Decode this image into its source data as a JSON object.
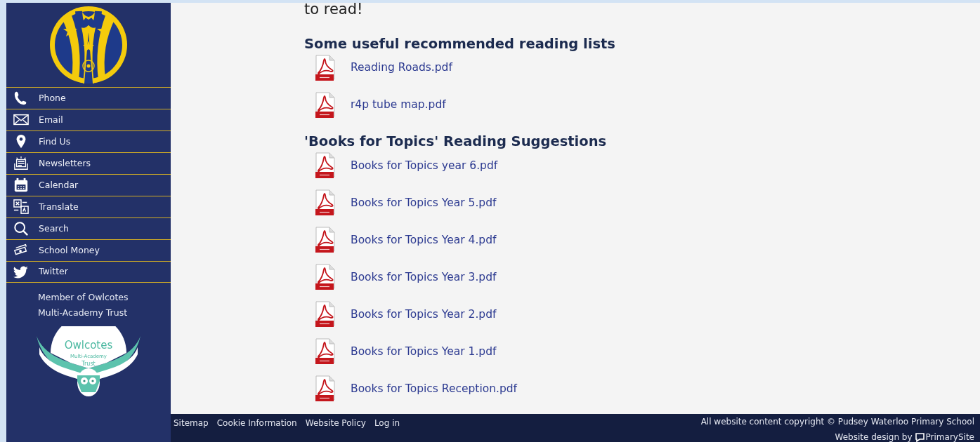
{
  "sidebar": {
    "nav_items": [
      {
        "label": "Phone",
        "kind": "phone"
      },
      {
        "label": "Email",
        "kind": "email"
      },
      {
        "label": "Find Us",
        "kind": "pin"
      },
      {
        "label": "Newsletters",
        "kind": "newsletter"
      },
      {
        "label": "Calendar",
        "kind": "calendar"
      },
      {
        "label": "Translate",
        "kind": "translate"
      },
      {
        "label": "Search",
        "kind": "search"
      },
      {
        "label": "School Money",
        "kind": "money"
      },
      {
        "label": "Twitter",
        "kind": "twitter"
      }
    ],
    "member_lines": [
      "Member of Owlcotes",
      "Multi-Academy Trust"
    ],
    "trust_logo": {
      "name": "Owlcotes",
      "line2": "Multi-Academy",
      "line3": "Trust"
    }
  },
  "content": {
    "intro_tail": "to read!",
    "sections": [
      {
        "heading": "Some useful recommended reading lists",
        "files": [
          "Reading Roads.pdf",
          "r4p tube map.pdf"
        ]
      },
      {
        "heading": "'Books for Topics' Reading Suggestions",
        "files": [
          "Books for Topics year 6.pdf",
          "Books for Topics Year 5.pdf",
          "Books for Topics Year 4.pdf",
          "Books for Topics Year 3.pdf",
          "Books for Topics Year 2.pdf",
          "Books for Topics Year 1.pdf",
          "Books for Topics Reception.pdf"
        ]
      }
    ]
  },
  "footer": {
    "links": [
      "Sitemap",
      "Cookie Information",
      "Website Policy",
      "Log in"
    ],
    "copyright": "All website content copyright © Pudsey Waterloo Primary School",
    "credit_prefix": "Website design by",
    "credit_brand": "PrimarySite"
  }
}
